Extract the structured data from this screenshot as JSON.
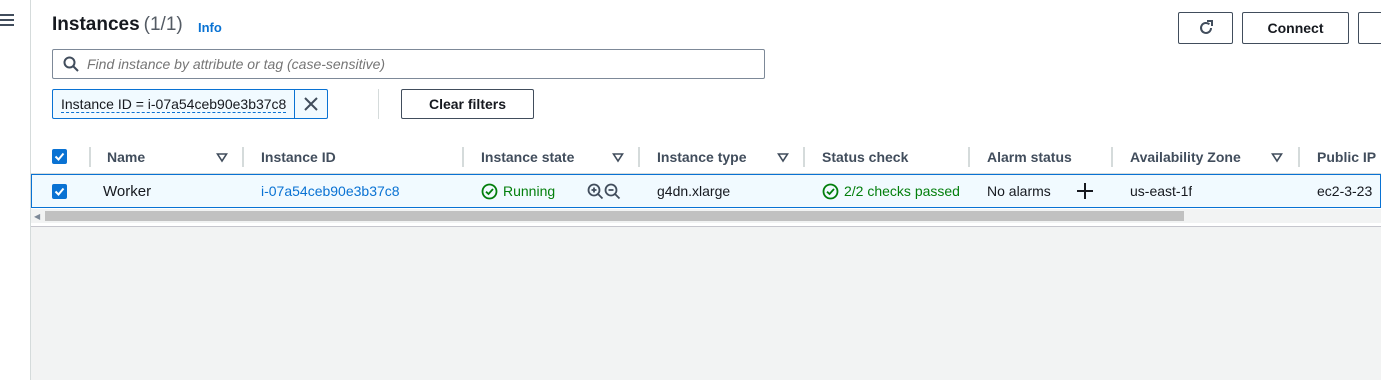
{
  "header": {
    "title": "Instances",
    "count": "(1/1)",
    "info": "Info",
    "connect_label": "Connect"
  },
  "search": {
    "placeholder": "Find instance by attribute or tag (case-sensitive)"
  },
  "filter": {
    "token": "Instance ID = i-07a54ceb90e3b37c8",
    "clear_label": "Clear filters"
  },
  "table": {
    "columns": [
      "Name",
      "Instance ID",
      "Instance state",
      "Instance type",
      "Status check",
      "Alarm status",
      "Availability Zone",
      "Public IP"
    ],
    "rows": [
      {
        "name": "Worker",
        "instance_id": "i-07a54ceb90e3b37c8",
        "state": "Running",
        "type": "g4dn.xlarge",
        "status_check": "2/2 checks passed",
        "alarm_status": "No alarms",
        "availability_zone": "us-east-1f",
        "public_ip": "ec2-3-23"
      }
    ]
  },
  "colors": {
    "accent": "#0972d3",
    "success": "#037f0c",
    "selected_row_bg": "#f1faff"
  }
}
